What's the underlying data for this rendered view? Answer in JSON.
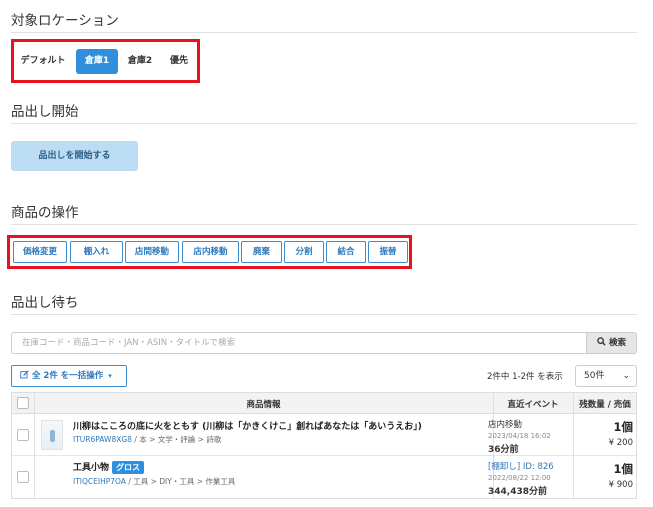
{
  "sections": {
    "location_title": "対象ロケーション",
    "start_title": "品出し開始",
    "ops_title": "商品の操作",
    "waiting_title": "品出し待ち"
  },
  "location_tabs": [
    {
      "label": "デフォルト",
      "active": false
    },
    {
      "label": "倉庫1",
      "active": true
    },
    {
      "label": "倉庫2",
      "active": false
    },
    {
      "label": "優先",
      "active": false
    }
  ],
  "start_button": "品出しを開始する",
  "operation_buttons": [
    "価格変更",
    "棚入れ",
    "店間移動",
    "店内移動",
    "廃棄",
    "分割",
    "結合",
    "振替"
  ],
  "search": {
    "placeholder": "在庫コード・商品コード・JAN・ASIN・タイトルで検索",
    "button_label": "検索",
    "icon": "search-icon"
  },
  "bulk_action": {
    "label": "全 2件 を一括操作",
    "icon": "edit-icon"
  },
  "pagination": {
    "count_text": "2件中 1-2件 を表示",
    "per_page": "50件"
  },
  "table": {
    "headers": [
      "商品情報",
      "直近イベント",
      "残数量 / 売価"
    ],
    "rows": [
      {
        "name": "川柳はこころの底に火をともす (川柳は「かきくけこ」創ればあなたは「あいうえお」)",
        "badge": "",
        "code": "ITUR6PAW8XG8",
        "category": " / 本 > 文学・評論 > 詩歌",
        "event_title": "店内移動",
        "event_is_link": false,
        "event_date": "2023/04/18 16:02",
        "event_ago": "36分前",
        "quantity": "1個",
        "price": "¥ 200",
        "has_thumbnail": true
      },
      {
        "name": "工具小物",
        "badge": "グロス",
        "code": "ITIQCEIHP7OA",
        "category": " / 工具 > DIY・工具 > 作業工具",
        "event_title": "[棚卸し] ID: 826",
        "event_is_link": true,
        "event_date": "2022/08/22 12:00",
        "event_ago": "344,438分前",
        "quantity": "1個",
        "price": "¥ 900",
        "has_thumbnail": false
      }
    ]
  },
  "colors": {
    "accent": "#2f8fdc",
    "highlight_box": "#e8121e",
    "start_button_bg": "#bcdcf3"
  }
}
